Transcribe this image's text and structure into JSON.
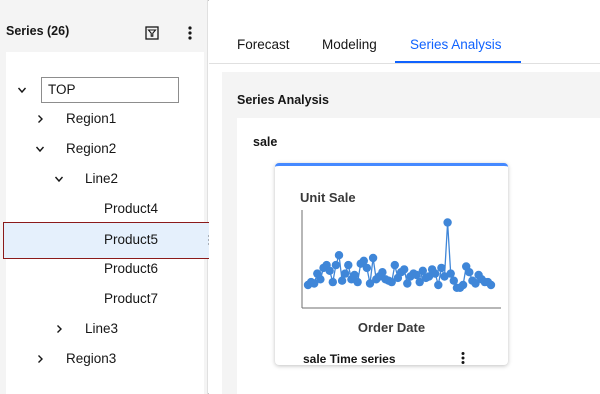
{
  "left_panel": {
    "title": "Series (26)",
    "filter_icon": "filter-icon",
    "overflow_icon": "overflow-menu-icon"
  },
  "tree": {
    "top_node": "TOP",
    "items": [
      {
        "label": "Region1",
        "expanded": false
      },
      {
        "label": "Region2",
        "expanded": true
      },
      {
        "label": "Line2",
        "expanded": true
      },
      {
        "label": "Product4"
      },
      {
        "label": "Product5",
        "selected": true
      },
      {
        "label": "Product6"
      },
      {
        "label": "Product7"
      },
      {
        "label": "Line3",
        "expanded": false
      },
      {
        "label": "Region3",
        "expanded": false
      }
    ]
  },
  "tabs": [
    {
      "label": "Forecast",
      "active": false
    },
    {
      "label": "Modeling",
      "active": false
    },
    {
      "label": "Series Analysis",
      "active": true
    }
  ],
  "content": {
    "title": "Series Analysis",
    "group_title": "sale",
    "card": {
      "footer_title": "sale Time series",
      "overflow_icon": "overflow-menu-icon"
    }
  },
  "colors": {
    "accent": "#0f62fe",
    "card_border": "#4589ff",
    "series": "#3f86d8",
    "selection_bg": "#e5f0fc",
    "selection_border": "#8b1a1a"
  },
  "chart_data": {
    "type": "line",
    "title": "",
    "xlabel": "Order Date",
    "ylabel": "Unit Sale",
    "x": [
      1,
      2,
      3,
      4,
      5,
      6,
      7,
      8,
      9,
      10,
      11,
      12,
      13,
      14,
      15,
      16,
      17,
      18,
      19,
      20,
      21,
      22,
      23,
      24,
      25,
      26,
      27,
      28,
      29,
      30,
      31,
      32,
      33,
      34,
      35,
      36,
      37,
      38,
      39,
      40,
      41,
      42,
      43,
      44,
      45,
      46,
      47,
      48,
      49,
      50,
      51,
      52,
      53,
      54,
      55,
      56,
      57,
      58,
      59,
      60
    ],
    "series": [
      {
        "values": [
          12,
          14,
          13,
          20,
          16,
          24,
          26,
          22,
          14,
          26,
          33,
          15,
          20,
          26,
          16,
          19,
          14,
          27,
          29,
          24,
          13,
          31,
          16,
          18,
          21,
          16,
          15,
          14,
          26,
          17,
          21,
          23,
          13,
          18,
          20,
          19,
          14,
          22,
          17,
          18,
          23,
          20,
          12,
          24,
          18,
          56,
          20,
          15,
          10,
          10,
          12,
          25,
          21,
          15,
          13,
          19,
          16,
          14,
          14,
          12
        ],
        "marker": "circle"
      }
    ],
    "ylim": [
      0,
      62
    ],
    "grid": false,
    "legend": "none"
  }
}
